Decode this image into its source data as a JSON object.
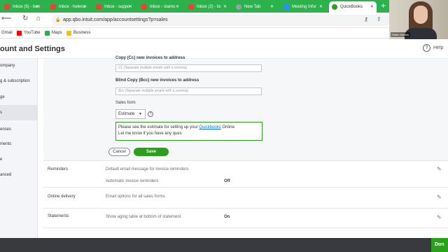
{
  "browser": {
    "tabs": [
      {
        "label": "Inbox (5) - ben",
        "favicon_color": "#ea4335"
      },
      {
        "label": "Inbox - helens",
        "favicon_color": "#ea4335"
      },
      {
        "label": "Inbox - suppo",
        "favicon_color": "#ea4335"
      },
      {
        "label": "Inbox - stamo",
        "favicon_color": "#ea4335"
      },
      {
        "label": "Inbox (2) - lic",
        "favicon_color": "#ea4335"
      },
      {
        "label": "New Tab",
        "favicon_color": "#9aa0a6"
      },
      {
        "label": "Meeting Infor",
        "favicon_color": "#2d8cff"
      },
      {
        "label": "QuickBooks",
        "favicon_color": "#2ca01c"
      }
    ],
    "new_tab_glyph": "+",
    "url": "app.qbo.intuit.com/app/accountsettings?p=sales",
    "bookmarks": [
      {
        "label": "Gmail",
        "icon_color": "#ea4335"
      },
      {
        "label": "YouTube",
        "icon_color": "#ff0000"
      },
      {
        "label": "Maps",
        "icon_color": "#34a853"
      },
      {
        "label": "Business",
        "icon_color": "#f4c20d"
      }
    ]
  },
  "page": {
    "title": "ount and Settings",
    "help_label": "Help",
    "help_glyph": "?"
  },
  "sidebar": {
    "items": [
      {
        "label": "ompany",
        "active": false
      },
      {
        "label": "g & subscription",
        "active": false
      },
      {
        "label": "ge",
        "active": false
      },
      {
        "label": "s",
        "active": true
      },
      {
        "label": "enses",
        "active": false
      },
      {
        "label": "ments",
        "active": false
      },
      {
        "label": "e",
        "active": false
      },
      {
        "label": "anced",
        "active": false
      }
    ]
  },
  "sales_form_panel": {
    "cc_label": "Copy (Cc) new invoices to address",
    "cc_placeholder": "Cc (Separate multiple emails with a comma)",
    "bcc_label": "Blind Copy (Bcc) new invoices to address",
    "bcc_placeholder": "Bcc (Separate multiple emails with a comma)",
    "sales_form_label": "Sales form",
    "sales_form_value": "Estimate",
    "info_glyph": "?",
    "message_line1_before": "Please see the estimate for setting up your ",
    "message_line1_link": "Quickbooks",
    "message_line1_after": " Online.",
    "message_line2": "Let me know if you have any ques",
    "cancel_label": "Cancel",
    "save_label": "Save"
  },
  "rows": [
    {
      "title": "Reminders",
      "text": "Default email message for invoice reminders",
      "value": ""
    },
    {
      "title": "",
      "text": "Automatic invoice reminders",
      "value": "Off"
    },
    {
      "title": "Online delivery",
      "text": "Email options for all sales forms",
      "value": ""
    },
    {
      "title": "Statements",
      "text": "Show aging table at bottom of statement",
      "value": "On"
    }
  ],
  "footer": {
    "done_label": "Don"
  },
  "webcam": {
    "name_label": "Helen Dennis"
  }
}
